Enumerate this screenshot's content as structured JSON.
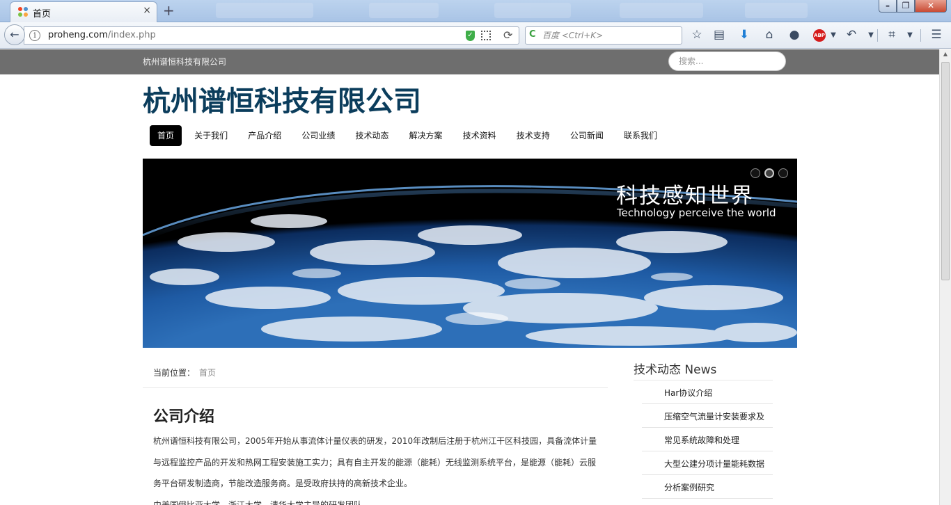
{
  "browser": {
    "tab_title": "首页",
    "tab_close": "×",
    "new_tab": "+",
    "back": "←",
    "url_host": "proheng.com",
    "url_path": "/index.php",
    "reload": "⟳",
    "search_placeholder": "百度 <Ctrl+K>",
    "win_min": "–",
    "win_max": "❐",
    "win_close": "✕",
    "toolbar_icons": [
      "star-icon",
      "reading-list-icon",
      "download-icon",
      "home-icon",
      "chat-icon",
      "adblock-icon",
      "undo-icon",
      "crop-icon",
      "menu-icon"
    ],
    "abp_label": "ABP"
  },
  "site": {
    "top_name": "杭州谱恒科技有限公司",
    "search_placeholder": "搜索...",
    "brand": "杭州谱恒科技有限公司",
    "menu": [
      "首页",
      "关于我们",
      "产品介绍",
      "公司业绩",
      "技术动态",
      "解决方案",
      "技术资料",
      "技术支持",
      "公司新闻",
      "联系我们"
    ],
    "active_menu": 0,
    "banner": {
      "title_cn": "科技感知世界",
      "title_en": "Technology perceive the world",
      "slides": 3,
      "active_slide": 2
    },
    "breadcrumb": {
      "label": "当前位置：",
      "current": "首页"
    },
    "article": {
      "title": "公司介绍",
      "paragraphs": [
        "杭州谱恒科技有限公司，2005年开始从事流体计量仪表的研发，2010年改制后注册于杭州江干区科技园，具备流体计量与远程监控产品的开发和热网工程安装施工实力；具有自主开发的能源（能耗）无线监测系统平台，是能源（能耗）云服务平台研发制造商，节能改造服务商。是受政府扶持的高新技术企业。",
        "由美国俄比亚大学、浙江大学、清华大学主导的研发团队"
      ]
    },
    "sidebar": {
      "title": "技术动态 News",
      "items": [
        "Har协议介绍",
        "压缩空气流量计安装要求及",
        "常见系统故障和处理",
        "大型公建分项计量能耗数据",
        "分析案例研究"
      ]
    }
  }
}
